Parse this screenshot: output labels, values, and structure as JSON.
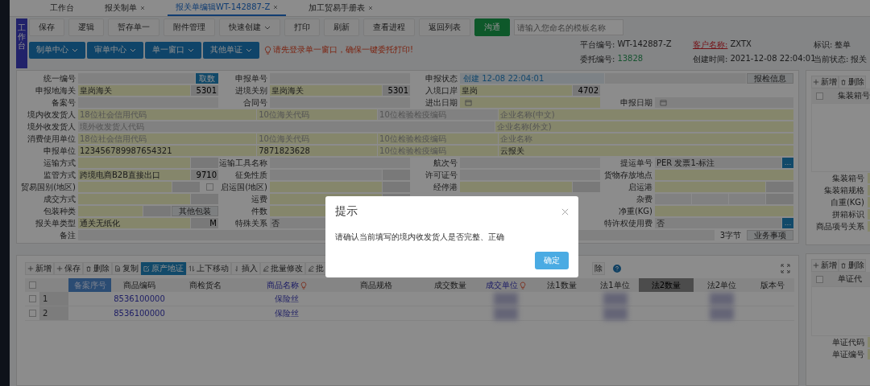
{
  "tabs": [
    {
      "label": "工作台",
      "selected": false,
      "closable": false
    },
    {
      "label": "报关制单",
      "selected": false,
      "closable": true
    },
    {
      "label": "报关单编辑WT-142887-Z",
      "selected": true,
      "closable": true
    },
    {
      "label": "加工贸易手册表",
      "selected": false,
      "closable": true
    }
  ],
  "side_badge": "工作台",
  "toolbar": [
    {
      "label": "保存",
      "kind": "plain"
    },
    {
      "label": "逻辑",
      "kind": "plain"
    },
    {
      "label": "暂存单一",
      "kind": "plain"
    },
    {
      "label": "附件管理",
      "kind": "plain"
    },
    {
      "label": "快速创建",
      "kind": "dropdown"
    },
    {
      "label": "打印",
      "kind": "plain"
    },
    {
      "label": "刷新",
      "kind": "plain"
    },
    {
      "label": "查看进程",
      "kind": "plain"
    },
    {
      "label": "返回列表",
      "kind": "plain"
    },
    {
      "label": "沟通",
      "kind": "primary"
    }
  ],
  "template_field": {
    "placeholder": "请输入您命名的模板名称"
  },
  "nav_buttons": [
    {
      "label": "制单中心"
    },
    {
      "label": "审单中心"
    },
    {
      "label": "单一窗口"
    },
    {
      "label": "其他单证"
    }
  ],
  "warning": "请先登录单一窗口，确保一键委托打印!",
  "info": [
    {
      "label": "平台编号:",
      "value": "WT-142887-Z",
      "kind": "plain"
    },
    {
      "label": "客户名称:",
      "value": "ZXTX",
      "kind": "alert"
    },
    {
      "label": "标识:",
      "value": "整单",
      "kind": "plain"
    },
    {
      "label": "委托编号:",
      "value": "13828",
      "kind": "count"
    },
    {
      "label": "创建时间:",
      "value": "2021-12-08 22:04:01",
      "kind": "plain"
    },
    {
      "label": "当前状态:",
      "value": "报关",
      "kind": "plain"
    }
  ],
  "form": {
    "rows": [
      {
        "items": [
          {
            "label": "统一编号",
            "parts": [
              {
                "kind": "input",
                "required": false
              },
              {
                "kind": "action",
                "label": "取数"
              }
            ]
          },
          {
            "label": "申报单号",
            "parts": [
              {
                "kind": "input",
                "required": false
              }
            ]
          },
          {
            "label": "申报状态",
            "parts": [
              {
                "kind": "status",
                "value": "创建 12-08 22:04:01"
              },
              {
                "kind": "input",
                "required": false
              },
              {
                "kind": "button",
                "label": "报检信息"
              }
            ]
          }
        ]
      },
      {
        "items": [
          {
            "label": "申报地海关",
            "parts": [
              {
                "kind": "input",
                "value": "皇岗海关",
                "required": true
              },
              {
                "kind": "code",
                "value": "5301",
                "required": false
              }
            ]
          },
          {
            "label": "进境关别",
            "parts": [
              {
                "kind": "input",
                "value": "皇岗海关",
                "required": true
              },
              {
                "kind": "code",
                "value": "5301",
                "required": false
              }
            ]
          },
          {
            "label": "入境口岸",
            "parts": [
              {
                "kind": "input",
                "value": "皇岗",
                "required": true
              },
              {
                "kind": "code",
                "value": "4702",
                "required": false
              }
            ]
          }
        ]
      },
      {
        "items": [
          {
            "label": "备案号",
            "parts": [
              {
                "kind": "input",
                "required": false
              }
            ]
          },
          {
            "label": "合同号",
            "parts": [
              {
                "kind": "input",
                "required": false
              }
            ]
          },
          {
            "label": "进出日期",
            "parts": [
              {
                "kind": "date",
                "required": true
              }
            ]
          },
          {
            "label": "申报日期",
            "parts": [
              {
                "kind": "date",
                "required": false
              }
            ]
          }
        ]
      },
      {
        "items": [
          {
            "label": "境内收发货人",
            "parts": [
              {
                "kind": "input",
                "placeholder": "18位社会信用代码",
                "required": true
              },
              {
                "kind": "input",
                "placeholder": "10位海关代码",
                "required": true
              },
              {
                "kind": "input",
                "placeholder": "10位检验检疫编码",
                "required": false
              },
              {
                "kind": "input",
                "placeholder": "企业名称(中文)",
                "required": true
              }
            ]
          }
        ]
      },
      {
        "items": [
          {
            "label": "境外收发货人",
            "parts": [
              {
                "kind": "input",
                "placeholder": "境外收发货人代码",
                "required": false
              },
              {
                "kind": "input",
                "placeholder": "企业名称(外文)",
                "required": true
              }
            ]
          }
        ]
      },
      {
        "items": [
          {
            "label": "消费使用单位",
            "parts": [
              {
                "kind": "input",
                "placeholder": "18位社会信用代码",
                "required": true
              },
              {
                "kind": "input",
                "placeholder": "10位海关代码",
                "required": true
              },
              {
                "kind": "input",
                "placeholder": "10位检验检疫编码",
                "required": true
              },
              {
                "kind": "input",
                "placeholder": "企业名称",
                "required": true
              }
            ]
          }
        ]
      },
      {
        "items": [
          {
            "label": "申报单位",
            "parts": [
              {
                "kind": "input",
                "value": "123456789987654321",
                "required": true
              },
              {
                "kind": "input",
                "value": "7871823628",
                "required": true
              },
              {
                "kind": "input",
                "placeholder": "10位检验检疫编码",
                "required": true
              },
              {
                "kind": "input",
                "value": "云报关",
                "required": true
              }
            ]
          }
        ]
      },
      {
        "items": [
          {
            "label": "运输方式",
            "parts": [
              {
                "kind": "input",
                "required": true
              },
              {
                "kind": "code",
                "required": false
              }
            ]
          },
          {
            "label": "运输工具名称",
            "parts": [
              {
                "kind": "input",
                "required": false
              }
            ]
          },
          {
            "label": "航次号",
            "parts": [
              {
                "kind": "input",
                "required": false
              }
            ]
          },
          {
            "label": "提运单号",
            "parts": [
              {
                "kind": "input",
                "value": "PER 发票1-标注",
                "required": false
              },
              {
                "kind": "more",
                "label": "..."
              }
            ]
          }
        ]
      },
      {
        "items": [
          {
            "label": "监管方式",
            "parts": [
              {
                "kind": "input",
                "value": "跨境电商B2B直接出口",
                "required": true
              },
              {
                "kind": "code",
                "value": "9710",
                "required": false
              }
            ]
          },
          {
            "label": "征免性质",
            "parts": [
              {
                "kind": "input",
                "required": false
              },
              {
                "kind": "code",
                "required": false
              }
            ]
          },
          {
            "label": "许可证号",
            "parts": [
              {
                "kind": "input",
                "required": false
              }
            ]
          },
          {
            "label": "货物存放地点",
            "parts": [
              {
                "kind": "input",
                "required": true
              }
            ]
          }
        ]
      },
      {
        "items": [
          {
            "label": "贸易国别(地区)",
            "parts": [
              {
                "kind": "input",
                "required": true
              },
              {
                "kind": "code",
                "required": false
              },
              {
                "kind": "checkbox",
                "checked": false
              }
            ]
          },
          {
            "label": "启运国(地区)",
            "parts": [
              {
                "kind": "input",
                "required": true
              },
              {
                "kind": "code",
                "required": false
              }
            ]
          },
          {
            "label": "经停港",
            "parts": [
              {
                "kind": "input",
                "required": true
              },
              {
                "kind": "code",
                "required": false
              }
            ]
          },
          {
            "label": "启运港",
            "parts": [
              {
                "kind": "input",
                "required": true
              },
              {
                "kind": "code",
                "required": false
              }
            ]
          }
        ]
      },
      {
        "items": [
          {
            "label": "成交方式",
            "parts": [
              {
                "kind": "input",
                "required": true
              },
              {
                "kind": "code",
                "required": false
              }
            ]
          },
          {
            "label": "运费",
            "parts": [
              {
                "kind": "input",
                "required": true
              },
              {
                "kind": "code",
                "required": false
              }
            ]
          },
          {
            "label": "杂费",
            "after_gap": true,
            "parts": [
              {
                "kind": "input",
                "required": false
              },
              {
                "kind": "input",
                "required": false
              },
              {
                "kind": "input",
                "required": false
              },
              {
                "kind": "code",
                "required": false
              }
            ]
          }
        ]
      },
      {
        "items": [
          {
            "label": "包装种类",
            "parts": [
              {
                "kind": "input",
                "required": true
              },
              {
                "kind": "code",
                "required": false
              },
              {
                "kind": "button",
                "label": "其他包装"
              }
            ]
          },
          {
            "label": "件数",
            "parts": [
              {
                "kind": "input",
                "required": true
              }
            ]
          },
          {
            "label": "净重(KG)",
            "after_gap": true,
            "parts": [
              {
                "kind": "input",
                "required": true
              }
            ]
          }
        ]
      },
      {
        "items": [
          {
            "label": "报关单类型",
            "parts": [
              {
                "kind": "input",
                "value": "通关无纸化",
                "required": true
              },
              {
                "kind": "code",
                "value": "M",
                "required": false
              }
            ]
          },
          {
            "label": "特殊关系",
            "parts": [
              {
                "kind": "input",
                "value": "否",
                "required": false
              }
            ]
          },
          {
            "label": "特许权使用费",
            "after_gap": true,
            "parts": [
              {
                "kind": "input",
                "value": "否",
                "required": false
              },
              {
                "kind": "more",
                "label": "..."
              }
            ]
          }
        ]
      },
      {
        "items": [
          {
            "label": "备注",
            "parts": [
              {
                "kind": "input",
                "required": false
              },
              {
                "kind": "note",
                "label": "3字节"
              },
              {
                "kind": "button",
                "label": "业务事项"
              }
            ]
          }
        ]
      }
    ]
  },
  "container_panel": {
    "header_checked": false,
    "toolbar": [
      {
        "label": "新增",
        "kind": "add"
      },
      {
        "label": "删除",
        "kind": "delete"
      }
    ],
    "column": "集装箱号",
    "fields": [
      "集装箱号",
      "集装箱规格",
      "自重(KG)",
      "拼箱标识",
      "商品项号关系"
    ]
  },
  "goods_toolbar": [
    {
      "label": "新增",
      "kind": "add",
      "selected": false
    },
    {
      "label": "保存",
      "kind": "add",
      "selected": false
    },
    {
      "label": "删除",
      "kind": "delete",
      "selected": false
    },
    {
      "label": "复制",
      "kind": "copy",
      "selected": false
    },
    {
      "label": "原产地证",
      "kind": "edit",
      "selected": true
    },
    {
      "label": "上下移动",
      "kind": "move",
      "selected": false
    },
    {
      "label": "插入",
      "kind": "insert",
      "selected": false
    },
    {
      "label": "批量修改",
      "kind": "pen",
      "selected": false
    },
    {
      "label": "批",
      "kind": "pen",
      "selected": false
    },
    {
      "label": "除",
      "kind": "text",
      "selected": false
    }
  ],
  "goods_table": {
    "header_checked": false,
    "columns": [
      {
        "label": "备案序号",
        "kind": "active"
      },
      {
        "label": "商品编码",
        "kind": "plain"
      },
      {
        "label": "商检货名",
        "kind": "plain"
      },
      {
        "label": "商品名称",
        "kind": "required"
      },
      {
        "label": "商品规格",
        "kind": "plain"
      },
      {
        "label": "成交数量",
        "kind": "plain"
      },
      {
        "label": "成交单位",
        "kind": "required"
      },
      {
        "label": "法1数量",
        "kind": "plain"
      },
      {
        "label": "法1单位",
        "kind": "plain"
      },
      {
        "label": "法2数量",
        "kind": "hover"
      },
      {
        "label": "法2单位",
        "kind": "plain"
      },
      {
        "label": "版本号",
        "kind": "plain"
      }
    ],
    "rows": [
      {
        "checked": false,
        "index": "1",
        "cells": [
          null,
          "8536100000",
          null,
          "保险丝",
          null,
          null,
          {
            "blurred": true
          },
          null,
          {
            "blurred": true
          },
          null,
          {
            "blurred": true
          },
          null
        ]
      },
      {
        "checked": false,
        "index": "2",
        "cells": [
          null,
          "8536100000",
          null,
          "保险丝",
          null,
          null,
          {
            "blurred": true
          },
          null,
          {
            "blurred": true
          },
          null,
          {
            "blurred": true
          },
          null
        ]
      }
    ]
  },
  "document_panel": {
    "header_checked": false,
    "toolbar": [
      {
        "label": "新增",
        "kind": "add"
      },
      {
        "label": "删除",
        "kind": "delete"
      }
    ],
    "column": "单证代",
    "fields": [
      "单证代码",
      "单证编号"
    ]
  },
  "dialog": {
    "title": "提示",
    "message": "请确认当前填写的境内收发货人是否完整、正确",
    "button": "确定"
  }
}
